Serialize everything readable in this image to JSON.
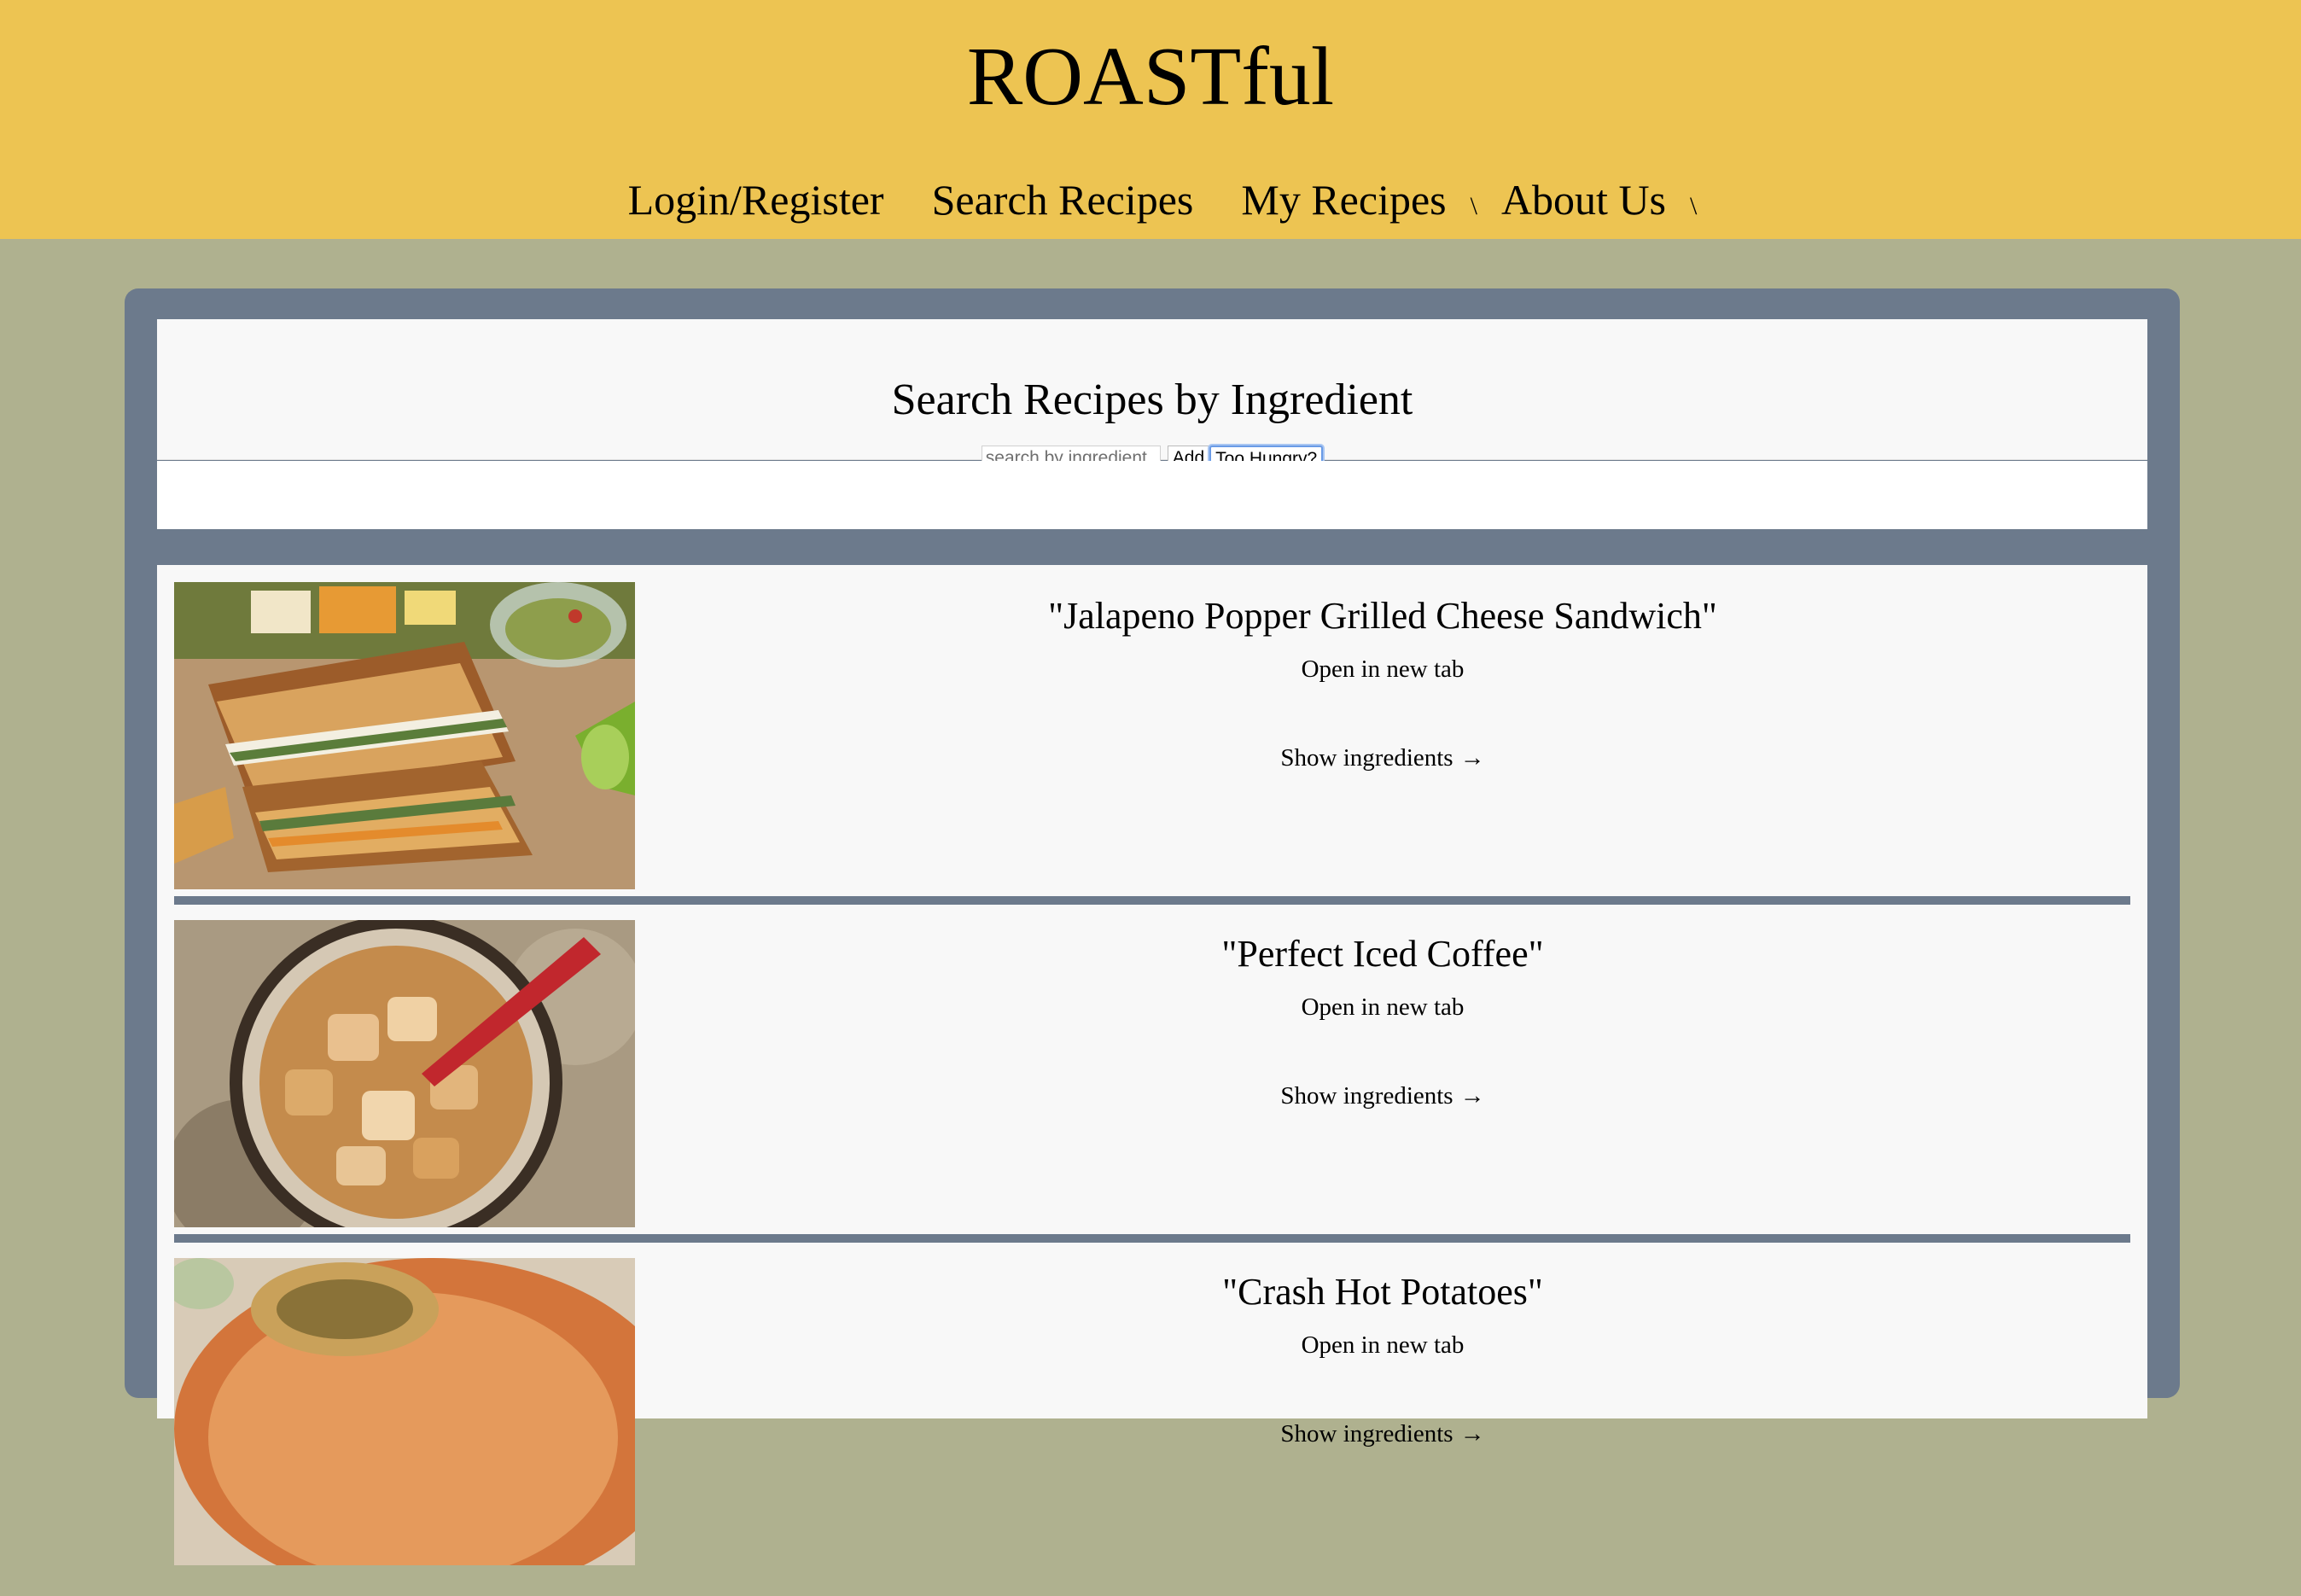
{
  "site": {
    "title": "ROASTful"
  },
  "nav": {
    "items": [
      {
        "label": "Login/Register"
      },
      {
        "label": "Search Recipes"
      },
      {
        "label": "My Recipes",
        "caret": "\\"
      },
      {
        "label": "About Us",
        "caret": "\\"
      }
    ]
  },
  "search": {
    "heading": "Search Recipes by Ingredient",
    "placeholder": "search by ingredient",
    "add_label": "Add",
    "hungry_label": "Too Hungry?"
  },
  "recipes": [
    {
      "title": "\"Jalapeno Popper Grilled Cheese Sandwich\"",
      "link": "Open in new tab",
      "ingredients": "Show ingredients",
      "arrow": "→"
    },
    {
      "title": "\"Perfect Iced Coffee\"",
      "link": "Open in new tab",
      "ingredients": "Show ingredients",
      "arrow": "→"
    },
    {
      "title": "\"Crash Hot Potatoes\"",
      "link": "Open in new tab",
      "ingredients": "Show ingredients",
      "arrow": "→"
    }
  ],
  "colors": {
    "header": "#edc452",
    "page_background": "#afb18f",
    "frame": "#6c7a8c",
    "panel": "#f8f8f8",
    "focus_ring": "#6a9be6"
  }
}
